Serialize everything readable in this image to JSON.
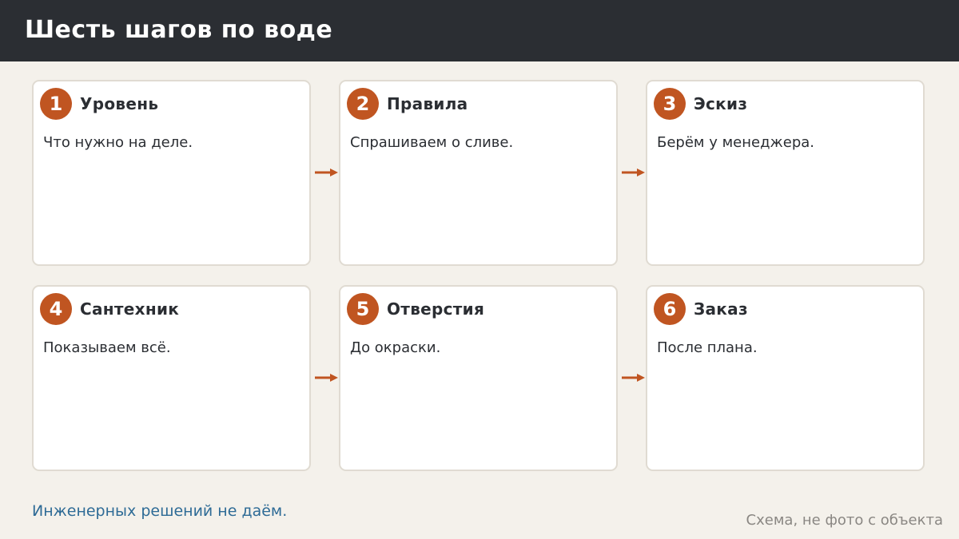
{
  "header": {
    "title": "Шесть шагов по воде"
  },
  "steps": [
    {
      "number": "1",
      "title": "Уровень",
      "description": "Что нужно на деле."
    },
    {
      "number": "2",
      "title": "Правила",
      "description": "Спрашиваем о сливе."
    },
    {
      "number": "3",
      "title": "Эскиз",
      "description": "Берём у менеджера."
    },
    {
      "number": "4",
      "title": "Сантехник",
      "description": "Показываем всё."
    },
    {
      "number": "5",
      "title": "Отверстия",
      "description": "До окраски."
    },
    {
      "number": "6",
      "title": "Заказ",
      "description": "После плана."
    }
  ],
  "footer": {
    "note": "Инженерных решений не даём.",
    "caption": "Схема, не фото с объекта"
  },
  "colors": {
    "header_bg": "#2b2e33",
    "background": "#f4f1eb",
    "accent": "#c05521",
    "card_border": "#e0dbd2",
    "note_text": "#2e6b96",
    "caption_text": "#8a8783"
  },
  "icons": {
    "connector": "arrow-right-icon"
  }
}
